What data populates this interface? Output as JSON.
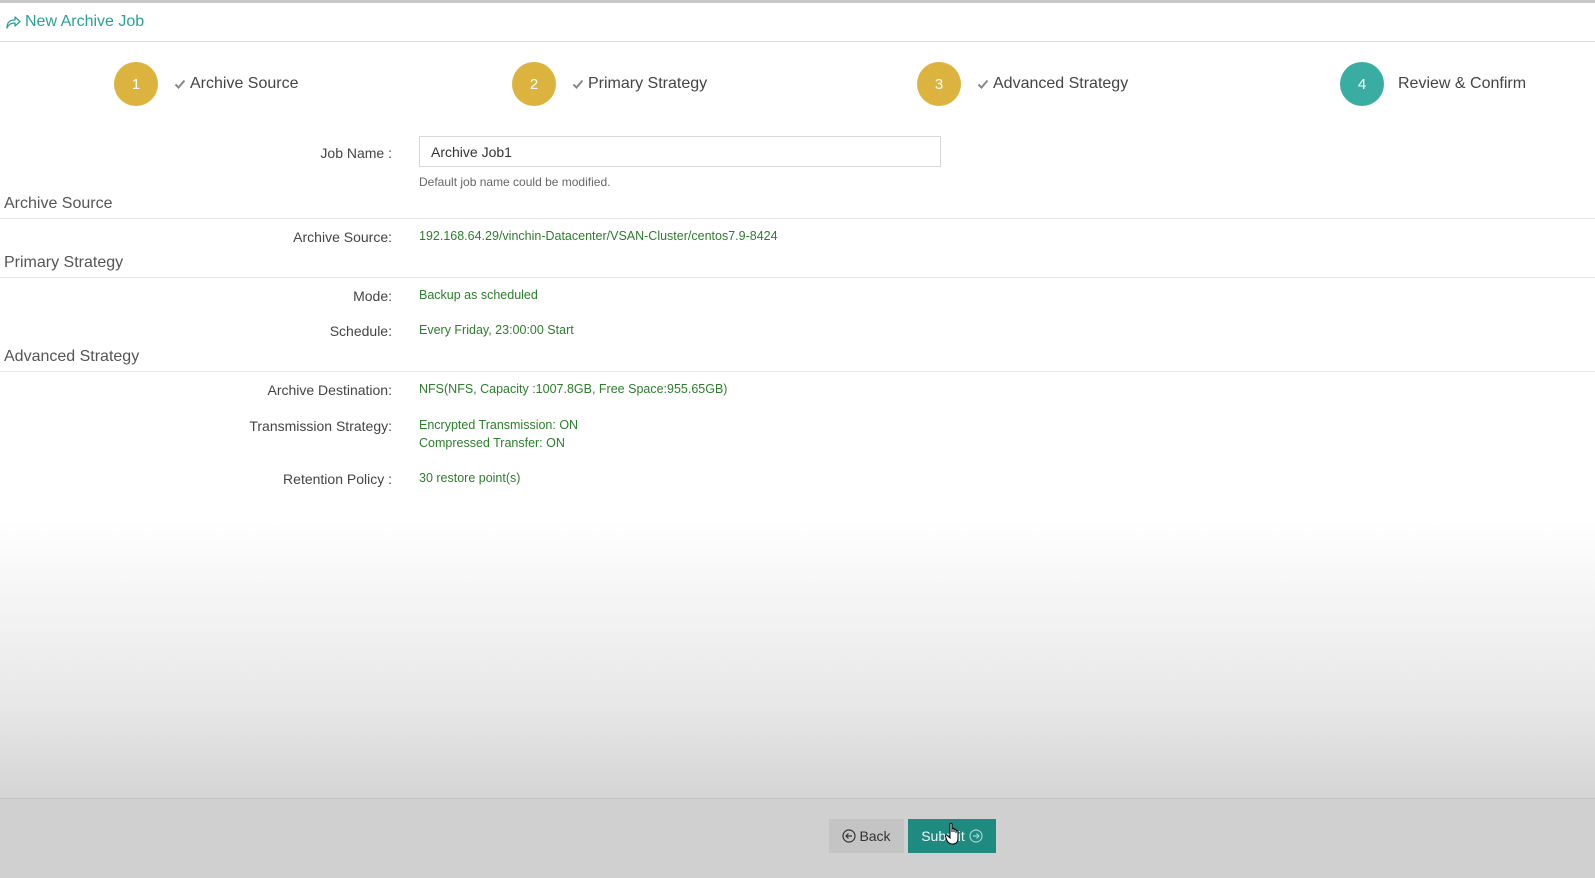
{
  "header": {
    "title": "New Archive Job",
    "icon": "share-icon"
  },
  "steps": [
    {
      "number": "1",
      "label": "Archive Source",
      "completed": true
    },
    {
      "number": "2",
      "label": "Primary Strategy",
      "completed": true
    },
    {
      "number": "3",
      "label": "Advanced Strategy",
      "completed": true
    },
    {
      "number": "4",
      "label": "Review & Confirm",
      "completed": false,
      "active": true
    }
  ],
  "colors": {
    "accent": "#2aa198",
    "step_completed": "#dcb33f",
    "step_active": "#3aada3",
    "value_text": "#2d7d2d",
    "submit": "#1f8a80"
  },
  "job": {
    "label": "Job Name :",
    "value": "Archive Job1",
    "hint": "Default job name could be modified."
  },
  "sections": {
    "archive_source": {
      "title": "Archive Source",
      "source_label": "Archive Source:",
      "source_value": "192.168.64.29/vinchin-Datacenter/VSAN-Cluster/centos7.9-8424"
    },
    "primary_strategy": {
      "title": "Primary Strategy",
      "mode_label": "Mode:",
      "mode_value": "Backup as scheduled",
      "schedule_label": "Schedule:",
      "schedule_value": "Every Friday, 23:00:00 Start"
    },
    "advanced_strategy": {
      "title": "Advanced Strategy",
      "destination_label": "Archive Destination:",
      "destination_value": "NFS(NFS, Capacity :1007.8GB, Free Space:955.65GB)",
      "transmission_label": "Transmission Strategy:",
      "transmission_value_1": "Encrypted Transmission: ON",
      "transmission_value_2": "Compressed Transfer: ON",
      "retention_label": "Retention Policy :",
      "retention_value": "30 restore point(s)"
    }
  },
  "footer": {
    "back_label": "Back",
    "submit_label": "Submit"
  }
}
